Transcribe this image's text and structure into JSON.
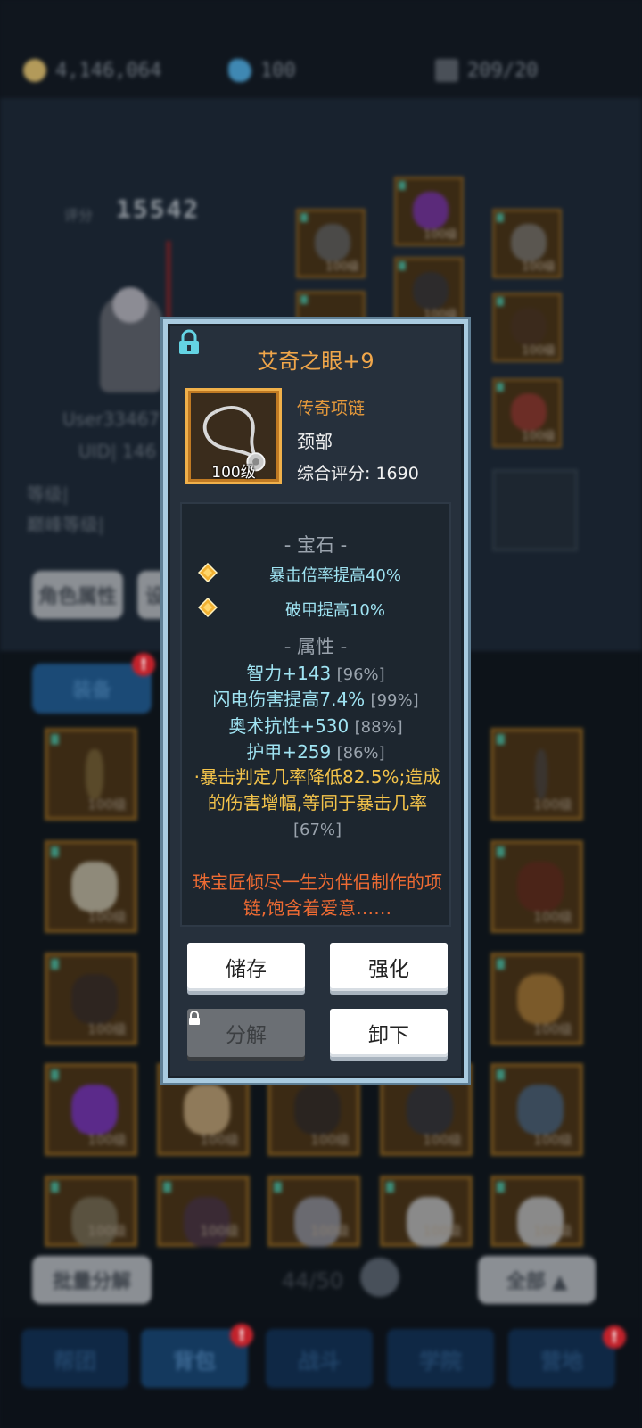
{
  "resources": {
    "gold": "4,146,064",
    "gems": "100",
    "stamina": "209/20"
  },
  "dialog": {
    "item_name": "艾奇之眼+9",
    "item_level": "100级",
    "item_type": "传奇项链",
    "item_slot": "颈部",
    "item_score": "综合评分: 1690",
    "gem_section_title": "- 宝石 -",
    "gems": [
      {
        "text": "暴击倍率提高40%"
      },
      {
        "text": "破甲提高10%"
      }
    ],
    "attr_section_title": "- 属性 -",
    "stats": [
      {
        "text": "智力+143",
        "pct": "[96%]"
      },
      {
        "text": "闪电伤害提高7.4%",
        "pct": "[99%]"
      },
      {
        "text": "奥术抗性+530",
        "pct": "[88%]"
      },
      {
        "text": "护甲+259",
        "pct": "[86%]"
      }
    ],
    "special_text": "·暴击判定几率降低82.5%;造成的伤害增幅,等同于暴击几率",
    "special_pct": "[67%]",
    "flavor_text": "珠宝匠倾尽一生为伴侣制作的项链,饱含着爱意……",
    "buttons": {
      "store": "储存",
      "enhance": "强化",
      "disassemble": "分解",
      "unequip": "卸下"
    }
  },
  "colors": {
    "accent_orange": "#f0a64a",
    "stat_cyan": "#9fe3f2",
    "special_yellow": "#f2c24a",
    "flavor_orange": "#ee6b33",
    "frame_border": "#a9cbe0"
  }
}
